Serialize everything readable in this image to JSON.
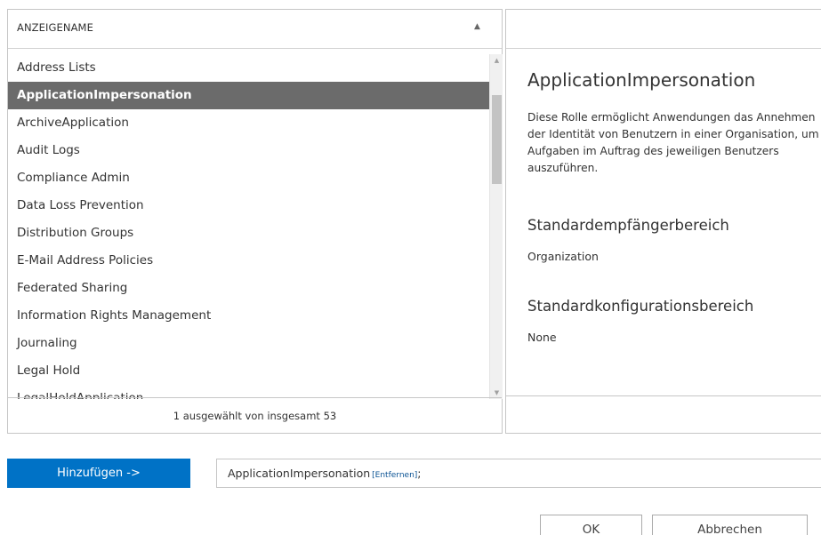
{
  "list": {
    "header": "ANZEIGENAME",
    "sort_icon": "▲",
    "items": [
      {
        "label": "Address Lists",
        "selected": false
      },
      {
        "label": "ApplicationImpersonation",
        "selected": true
      },
      {
        "label": "ArchiveApplication",
        "selected": false
      },
      {
        "label": "Audit Logs",
        "selected": false
      },
      {
        "label": "Compliance Admin",
        "selected": false
      },
      {
        "label": "Data Loss Prevention",
        "selected": false
      },
      {
        "label": "Distribution Groups",
        "selected": false
      },
      {
        "label": "E-Mail Address Policies",
        "selected": false
      },
      {
        "label": "Federated Sharing",
        "selected": false
      },
      {
        "label": "Information Rights Management",
        "selected": false
      },
      {
        "label": "Journaling",
        "selected": false
      },
      {
        "label": "Legal Hold",
        "selected": false
      },
      {
        "label": "LegalHoldApplication",
        "selected": false
      }
    ],
    "footer": "1 ausgewählt von insgesamt 53"
  },
  "detail": {
    "title": "ApplicationImpersonation",
    "description": "Diese Rolle ermöglicht Anwendungen das Annehmen der Identität von Benutzern in einer Organisation, um Aufgaben im Auftrag des jeweiligen Benutzers auszuführen.",
    "recipient_scope_label": "Standardempfängerbereich",
    "recipient_scope_value": "Organization",
    "config_scope_label": "Standardkonfigurationsbereich",
    "config_scope_value": "None"
  },
  "add_button_label": "Hinzufügen ->",
  "selection": {
    "value": "ApplicationImpersonation",
    "remove_label": "[Entfernen]",
    "separator": ";"
  },
  "buttons": {
    "ok": "OK",
    "cancel": "Abbrechen"
  },
  "colors": {
    "accent": "#0072c6",
    "selected_row": "#6b6b6b"
  }
}
